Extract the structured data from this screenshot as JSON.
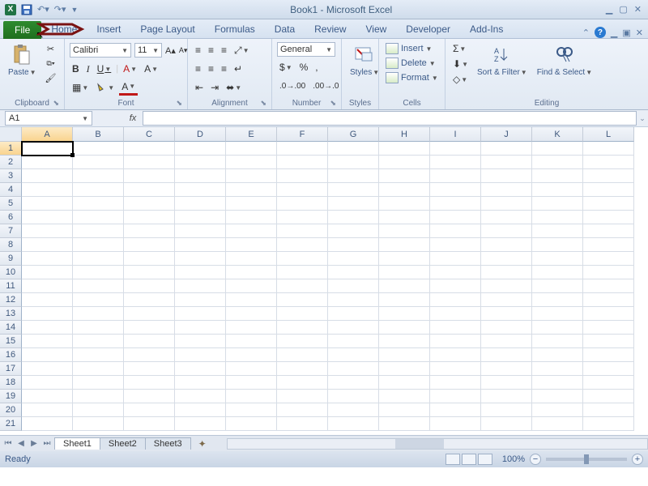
{
  "title": "Book1 - Microsoft Excel",
  "tabs": {
    "file": "File",
    "home": "Home",
    "insert": "Insert",
    "page_layout": "Page Layout",
    "formulas": "Formulas",
    "data": "Data",
    "review": "Review",
    "view": "View",
    "developer": "Developer",
    "addins": "Add-Ins"
  },
  "ribbon": {
    "clipboard": {
      "label": "Clipboard",
      "paste": "Paste"
    },
    "font": {
      "label": "Font",
      "name": "Calibri",
      "size": "11",
      "bold": "B",
      "italic": "I",
      "underline": "U",
      "font_A": "A"
    },
    "alignment": {
      "label": "Alignment"
    },
    "number": {
      "label": "Number",
      "format": "General",
      "currency": "$",
      "percent": "%",
      "comma": ","
    },
    "styles": {
      "label": "Styles",
      "btn": "Styles"
    },
    "cells": {
      "label": "Cells",
      "insert": "Insert",
      "delete": "Delete",
      "format": "Format"
    },
    "editing": {
      "label": "Editing",
      "sigma": "Σ",
      "sort": "Sort & Filter",
      "find": "Find & Select"
    }
  },
  "namebox": "A1",
  "fx": "fx",
  "columns": [
    "A",
    "B",
    "C",
    "D",
    "E",
    "F",
    "G",
    "H",
    "I",
    "J",
    "K",
    "L"
  ],
  "rows": [
    "1",
    "2",
    "3",
    "4",
    "5",
    "6",
    "7",
    "8",
    "9",
    "10",
    "11",
    "12",
    "13",
    "14",
    "15",
    "16",
    "17",
    "18",
    "19",
    "20",
    "21"
  ],
  "active_cell": "A1",
  "sheets": {
    "s1": "Sheet1",
    "s2": "Sheet2",
    "s3": "Sheet3"
  },
  "status": {
    "ready": "Ready",
    "zoom": "100%",
    "minus": "−",
    "plus": "+"
  }
}
